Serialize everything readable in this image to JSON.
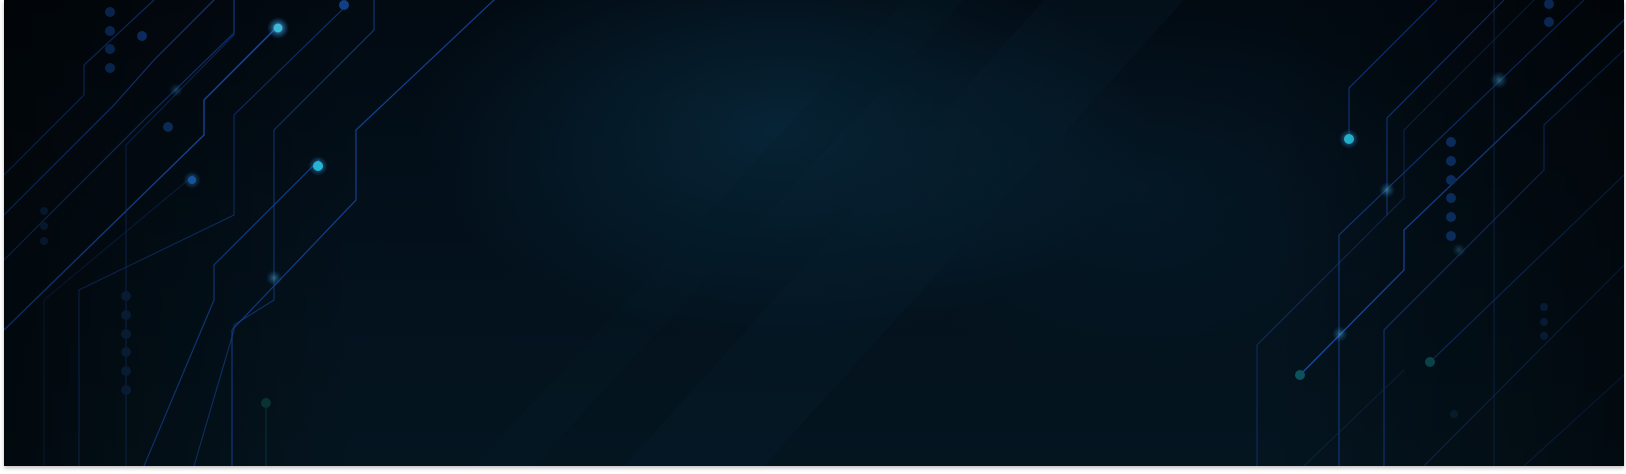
{
  "banner": {
    "background": "#031320",
    "trace_color": "#1f5fd6",
    "node_color": "#27c3e0",
    "dim_node_color": "#0f3b63"
  }
}
